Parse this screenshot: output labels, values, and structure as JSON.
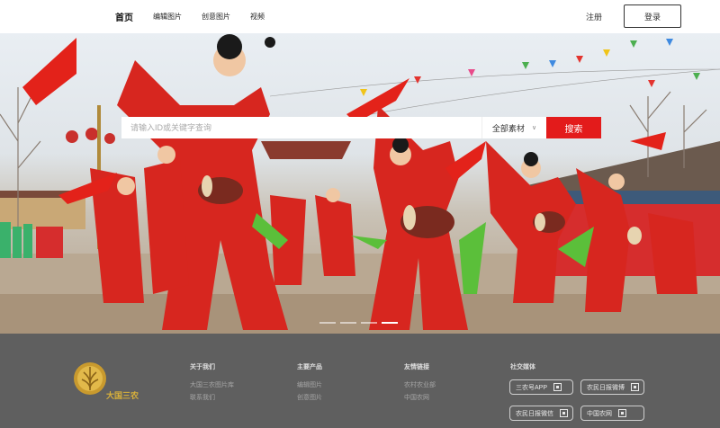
{
  "nav": {
    "items": [
      {
        "label": "首页",
        "active": true
      },
      {
        "label": "编辑图片",
        "active": false
      },
      {
        "label": "创意图片",
        "active": false
      },
      {
        "label": "视频",
        "active": false
      }
    ],
    "register": "注册",
    "login": "登录"
  },
  "search": {
    "placeholder": "请输入ID或关键字查询",
    "category": "全部素材",
    "button": "搜索"
  },
  "hero": {
    "slide_count": 4,
    "active_slide": 4
  },
  "footer": {
    "logo_text": "大国三农",
    "columns": [
      {
        "title": "关于我们",
        "links": [
          "大国三农图片库",
          "联系我们"
        ]
      },
      {
        "title": "主要产品",
        "links": [
          "编辑图片",
          "创意图片"
        ]
      },
      {
        "title": "友情链接",
        "links": [
          "农村农业部",
          "中国农网"
        ]
      }
    ],
    "social": {
      "title": "社交媒体",
      "buttons": [
        "三农号APP",
        "农民日报微博",
        "农民日报微信",
        "中国农网"
      ]
    }
  },
  "colors": {
    "accent": "#e31b1b",
    "footer_bg": "#5f5f5f",
    "logo_gold": "#d9b13a"
  }
}
